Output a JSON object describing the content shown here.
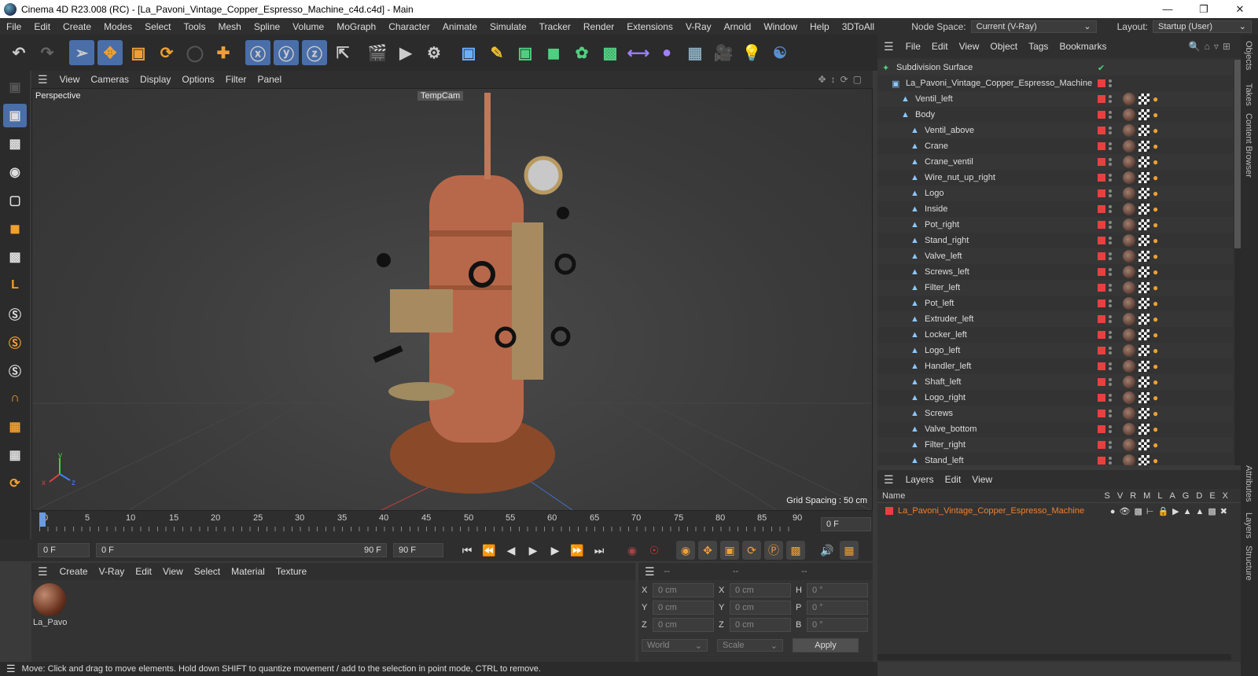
{
  "window": {
    "title": "Cinema 4D R23.008 (RC) - [La_Pavoni_Vintage_Copper_Espresso_Machine_c4d.c4d] - Main"
  },
  "menubar": {
    "items": [
      "File",
      "Edit",
      "Create",
      "Modes",
      "Select",
      "Tools",
      "Mesh",
      "Spline",
      "Volume",
      "MoGraph",
      "Character",
      "Animate",
      "Simulate",
      "Tracker",
      "Render",
      "Extensions",
      "V-Ray",
      "Arnold",
      "Window",
      "Help",
      "3DToAll"
    ],
    "node_space_label": "Node Space:",
    "node_space_value": "Current (V-Ray)",
    "layout_label": "Layout:",
    "layout_value": "Startup (User)"
  },
  "viewport": {
    "menu": [
      "View",
      "Cameras",
      "Display",
      "Options",
      "Filter",
      "Panel"
    ],
    "name": "Perspective",
    "camera": "TempCam",
    "grid_spacing": "Grid Spacing : 50 cm"
  },
  "timeline": {
    "ticks": [
      "0",
      "5",
      "10",
      "15",
      "20",
      "25",
      "30",
      "35",
      "40",
      "45",
      "50",
      "55",
      "60",
      "65",
      "70",
      "75",
      "80",
      "85",
      "90"
    ],
    "current_frame": "0 F",
    "start_field": "0 F",
    "range_start": "0 F",
    "range_end": "90 F",
    "end_field": "90 F"
  },
  "material_manager": {
    "menu": [
      "Create",
      "V-Ray",
      "Edit",
      "View",
      "Select",
      "Material",
      "Texture"
    ],
    "material_name": "La_Pavor"
  },
  "coordinates": {
    "headers": [
      "--",
      "--",
      "--"
    ],
    "rows": [
      {
        "a": "X",
        "av": "0 cm",
        "b": "X",
        "bv": "0 cm",
        "c": "H",
        "cv": "0 °"
      },
      {
        "a": "Y",
        "av": "0 cm",
        "b": "Y",
        "bv": "0 cm",
        "c": "P",
        "cv": "0 °"
      },
      {
        "a": "Z",
        "av": "0 cm",
        "b": "Z",
        "bv": "0 cm",
        "c": "B",
        "cv": "0 °"
      }
    ],
    "space": "World",
    "mode": "Scale",
    "apply": "Apply"
  },
  "status": "Move: Click and drag to move elements. Hold down SHIFT to quantize movement / add to the selection in point mode, CTRL to remove.",
  "object_manager": {
    "menu": [
      "File",
      "Edit",
      "View",
      "Object",
      "Tags",
      "Bookmarks"
    ],
    "objects": [
      {
        "name": "Subdivision Surface",
        "indent": 0,
        "icon": "subdiv"
      },
      {
        "name": "La_Pavoni_Vintage_Copper_Espresso_Machine",
        "indent": 1,
        "icon": "null"
      },
      {
        "name": "Ventil_left",
        "indent": 2,
        "icon": "poly"
      },
      {
        "name": "Body",
        "indent": 2,
        "icon": "poly"
      },
      {
        "name": "Ventil_above",
        "indent": 3,
        "icon": "poly"
      },
      {
        "name": "Crane",
        "indent": 3,
        "icon": "poly"
      },
      {
        "name": "Crane_ventil",
        "indent": 3,
        "icon": "poly"
      },
      {
        "name": "Wire_nut_up_right",
        "indent": 3,
        "icon": "poly"
      },
      {
        "name": "Logo",
        "indent": 3,
        "icon": "poly"
      },
      {
        "name": "Inside",
        "indent": 3,
        "icon": "poly"
      },
      {
        "name": "Pot_right",
        "indent": 3,
        "icon": "poly"
      },
      {
        "name": "Stand_right",
        "indent": 3,
        "icon": "poly"
      },
      {
        "name": "Valve_left",
        "indent": 3,
        "icon": "poly"
      },
      {
        "name": "Screws_left",
        "indent": 3,
        "icon": "poly"
      },
      {
        "name": "Filter_left",
        "indent": 3,
        "icon": "poly"
      },
      {
        "name": "Pot_left",
        "indent": 3,
        "icon": "poly"
      },
      {
        "name": "Extruder_left",
        "indent": 3,
        "icon": "poly"
      },
      {
        "name": "Locker_left",
        "indent": 3,
        "icon": "poly"
      },
      {
        "name": "Logo_left",
        "indent": 3,
        "icon": "poly"
      },
      {
        "name": "Handler_left",
        "indent": 3,
        "icon": "poly"
      },
      {
        "name": "Shaft_left",
        "indent": 3,
        "icon": "poly"
      },
      {
        "name": "Logo_right",
        "indent": 3,
        "icon": "poly"
      },
      {
        "name": "Screws",
        "indent": 3,
        "icon": "poly"
      },
      {
        "name": "Valve_bottom",
        "indent": 3,
        "icon": "poly"
      },
      {
        "name": "Filter_right",
        "indent": 3,
        "icon": "poly"
      },
      {
        "name": "Stand_left",
        "indent": 3,
        "icon": "poly"
      }
    ]
  },
  "layers": {
    "menu": [
      "Layers",
      "Edit",
      "View"
    ],
    "name_header": "Name",
    "flag_headers": [
      "S",
      "V",
      "R",
      "M",
      "L",
      "A",
      "G",
      "D",
      "E",
      "X"
    ],
    "layer_name": "La_Pavoni_Vintage_Copper_Espresso_Machine"
  },
  "right_tabs": [
    "Objects",
    "Takes",
    "Content Browser",
    "Attributes",
    "Layers",
    "Structure"
  ]
}
